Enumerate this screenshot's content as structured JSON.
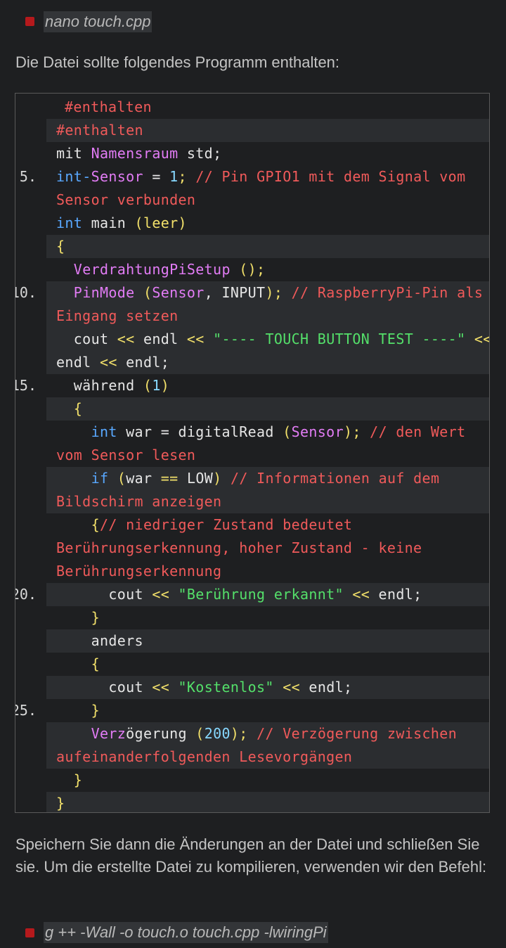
{
  "top_command": "nano touch.cpp",
  "intro_text": "Die Datei sollte folgendes Programm enthalten:",
  "line_numbers": [
    "5.",
    "10.",
    "15.",
    "20.",
    "25."
  ],
  "code": {
    "l1": "#enthalten",
    "l2": "#enthalten",
    "l3": [
      "mit ",
      "Namensraum",
      " std;"
    ],
    "l4a": [
      "int",
      "-",
      "Sensor",
      " = ",
      "1",
      "; ",
      "// Pin GPIO1 mit dem Signal vom"
    ],
    "l4b": "Sensor verbunden",
    "l5": [
      "int",
      " main ",
      "(",
      "leer",
      ")"
    ],
    "l6": "{",
    "l7": [
      "  ",
      "VerdrahtungPiSetup",
      " ",
      "()",
      ";"
    ],
    "l8a": [
      "  ",
      "PinMode",
      " (",
      "Sensor",
      ", INPUT",
      ")",
      "; ",
      "// RaspberryPi-Pin als"
    ],
    "l8b": "Eingang setzen",
    "l9a": [
      "  cout ",
      "<<",
      " endl ",
      "<<",
      " ",
      "\"---- TOUCH BUTTON TEST ----\"",
      " ",
      "<<"
    ],
    "l9b": [
      "endl ",
      "<<",
      " endl;"
    ],
    "l10": [
      "  während ",
      "(",
      "1",
      ")"
    ],
    "l11": "  {",
    "l12a": [
      "    ",
      "int",
      " war = digitalRead ",
      "(",
      "Sensor",
      ")",
      "; ",
      "// den Wert"
    ],
    "l12b": "vom Sensor lesen",
    "l13a": [
      "    ",
      "if",
      " ",
      "(",
      "war ",
      "==",
      " LOW",
      ")",
      " ",
      "// Informationen auf dem"
    ],
    "l13b": "Bildschirm anzeigen",
    "l14a": [
      "    ",
      "{",
      "// niedriger Zustand bedeutet"
    ],
    "l14b": "Berührungserkennung, hoher Zustand - keine",
    "l14c": "Berührungserkennung",
    "l15": [
      "      cout ",
      "<<",
      " ",
      "\"Berührung erkannt\"",
      " ",
      "<<",
      " endl;"
    ],
    "l16": "    }",
    "l17": "    anders",
    "l18": "    {",
    "l19": [
      "      cout ",
      "<<",
      " ",
      "\"Kostenlos\"",
      " ",
      "<<",
      " endl;"
    ],
    "l20": "    }",
    "l21a": [
      "    ",
      "Verz",
      "ögerung ",
      "(",
      "200",
      ")",
      "; ",
      "// Verzögerung zwischen"
    ],
    "l21b": "aufeinanderfolgenden Lesevorgängen",
    "l22": "  }",
    "l23": "}"
  },
  "save_text": "Speichern Sie dann die Änderungen an der Datei und schließen Sie sie. Um die erstellte Datei zu kompilieren, verwenden wir den Befehl:",
  "bottom_command": "g ++ -Wall -o touch.o touch.cpp -lwiringPi"
}
